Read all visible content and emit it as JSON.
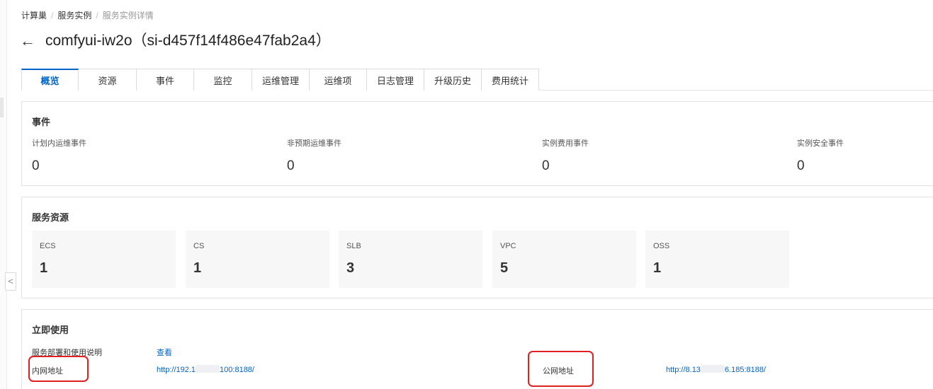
{
  "breadcrumb": {
    "items": [
      "计算巢",
      "服务实例",
      "服务实例详情"
    ],
    "separator": "/"
  },
  "header": {
    "back_icon": "arrow-left-icon",
    "back_glyph": "←",
    "title": "comfyui-iw2o（si-d457f14f486e47fab2a4）"
  },
  "tabs": [
    "概览",
    "资源",
    "事件",
    "监控",
    "运维管理",
    "运维项",
    "日志管理",
    "升级历史",
    "费用统计"
  ],
  "active_tab": "概览",
  "events": {
    "title": "事件",
    "items": [
      {
        "label": "计划内运维事件",
        "value": "0"
      },
      {
        "label": "非预期运维事件",
        "value": "0"
      },
      {
        "label": "实例费用事件",
        "value": "0"
      },
      {
        "label": "实例安全事件",
        "value": "0"
      }
    ]
  },
  "resources": {
    "title": "服务资源",
    "items": [
      {
        "label": "ECS",
        "value": "1"
      },
      {
        "label": "CS",
        "value": "1"
      },
      {
        "label": "SLB",
        "value": "3"
      },
      {
        "label": "VPC",
        "value": "5"
      },
      {
        "label": "OSS",
        "value": "1"
      }
    ]
  },
  "usage": {
    "title": "立即使用",
    "deploy_label": "服务部署和使用说明",
    "deploy_link": "查看",
    "private_label": "内网地址",
    "private_url_prefix": "http://192.1",
    "private_url_suffix": "100:8188/",
    "public_label": "公网地址",
    "public_url_prefix": "http://8.13",
    "public_url_suffix": "6.185:8188/"
  },
  "sidebar": {
    "collapse_icon": "chevron-left-icon",
    "collapse_glyph": "<"
  },
  "colors": {
    "accent": "#0064c8",
    "highlight": "#e02020",
    "tile_bg": "#f7f7f7"
  }
}
